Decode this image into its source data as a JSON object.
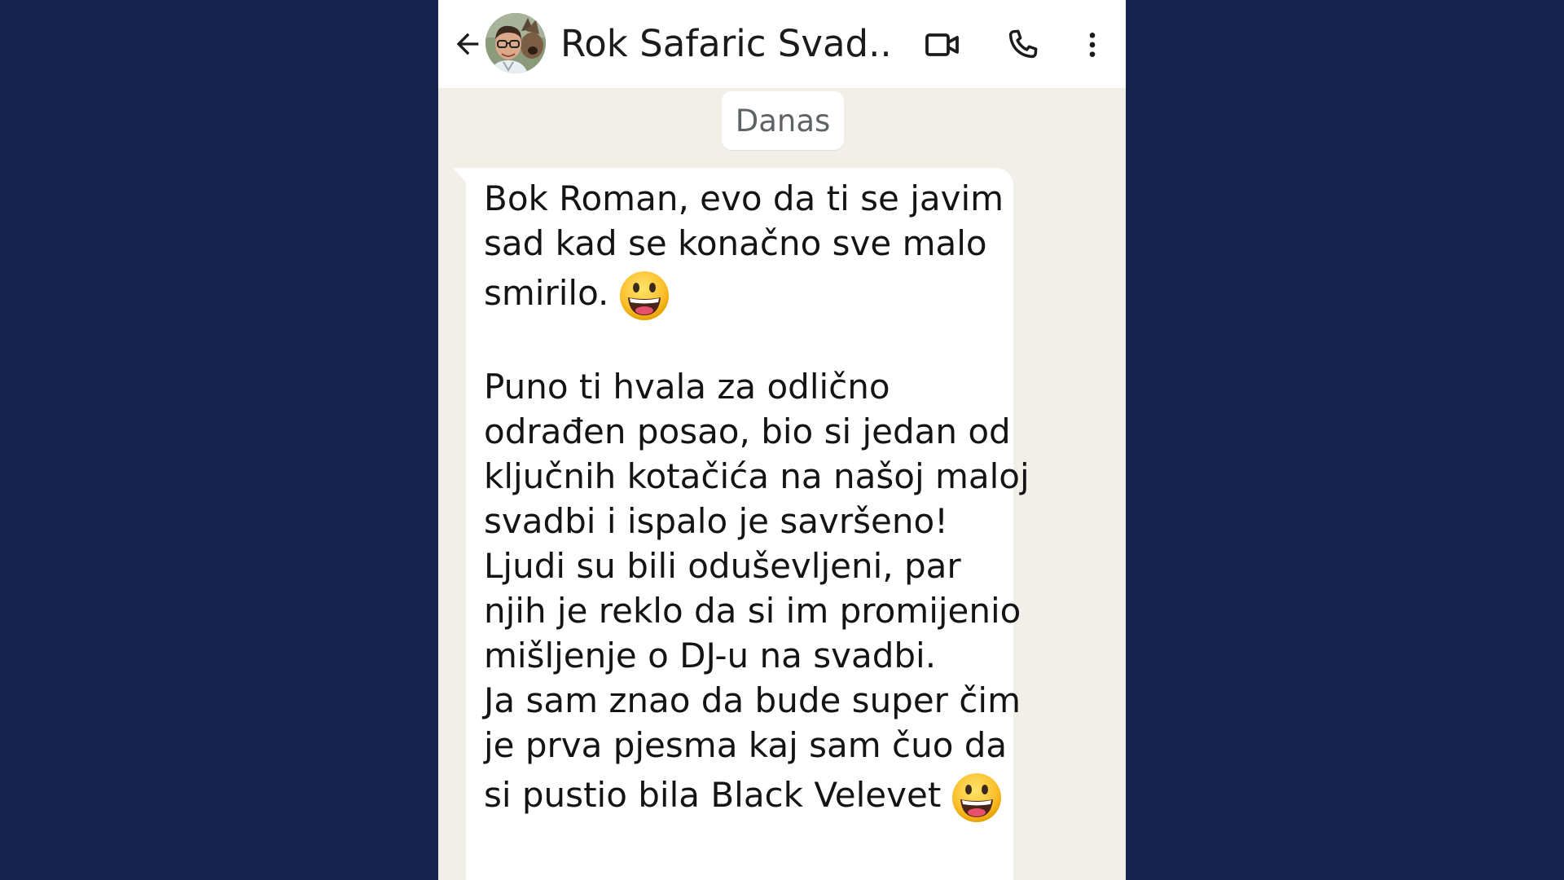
{
  "header": {
    "contact_name": "Rok Safaric Svad...",
    "back_icon": "arrow-left-icon",
    "video_icon": "video-camera-icon",
    "call_icon": "phone-icon",
    "menu_icon": "more-vertical-icon"
  },
  "chat": {
    "date_label": "Danas",
    "message": {
      "lines": [
        "Bok Roman, evo da ti se javim",
        "sad kad se konačno sve malo",
        "smirilo.",
        "Puno ti hvala za odlično",
        "odrađen posao, bio si jedan od",
        "ključnih kotačića na našoj maloj",
        "svadbi i ispalo je savršeno!",
        "Ljudi su bili oduševljeni, par",
        "njih je reklo da si im promijenio",
        "mišljenje o DJ-u na svadbi.",
        "Ja sam znao da bude super čim",
        "je prva pjesma kaj sam čuo da",
        "si pustio bila Black Velevet"
      ],
      "emoji": "grinning-face-emoji"
    }
  },
  "colors": {
    "background": "#182350",
    "chat_background": "#f2efe9",
    "bubble": "#ffffff",
    "header": "#ffffff"
  }
}
